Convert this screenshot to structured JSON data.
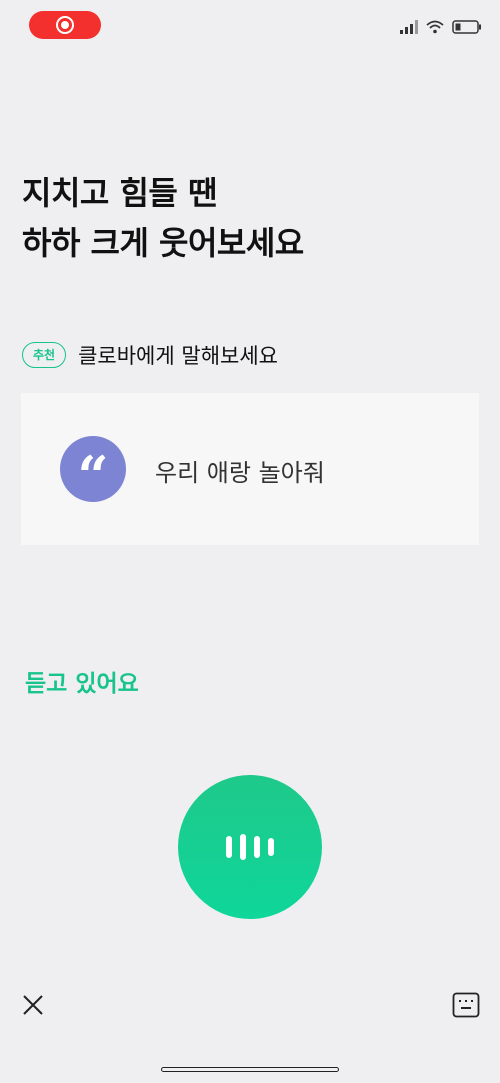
{
  "headline": {
    "line1": "지치고 힘들 땐",
    "line2": "하하 크게 웃어보세요"
  },
  "recommend": {
    "badge": "추천",
    "text": "클로바에게 말해보세요"
  },
  "suggestion": {
    "quote_icon": "quote-icon",
    "text": "우리 애랑 놀아줘"
  },
  "listening": {
    "label": "듣고 있어요"
  },
  "colors": {
    "accent": "#18c48a",
    "quote_bg": "#7d84d4",
    "record": "#f3302d",
    "background": "#efeff1"
  },
  "icons": {
    "close": "close-icon",
    "keyboard": "keyboard-icon",
    "mic": "voice-wave-icon",
    "record": "screen-record-icon",
    "signal": "signal-icon",
    "wifi": "wifi-icon",
    "battery": "battery-icon"
  }
}
